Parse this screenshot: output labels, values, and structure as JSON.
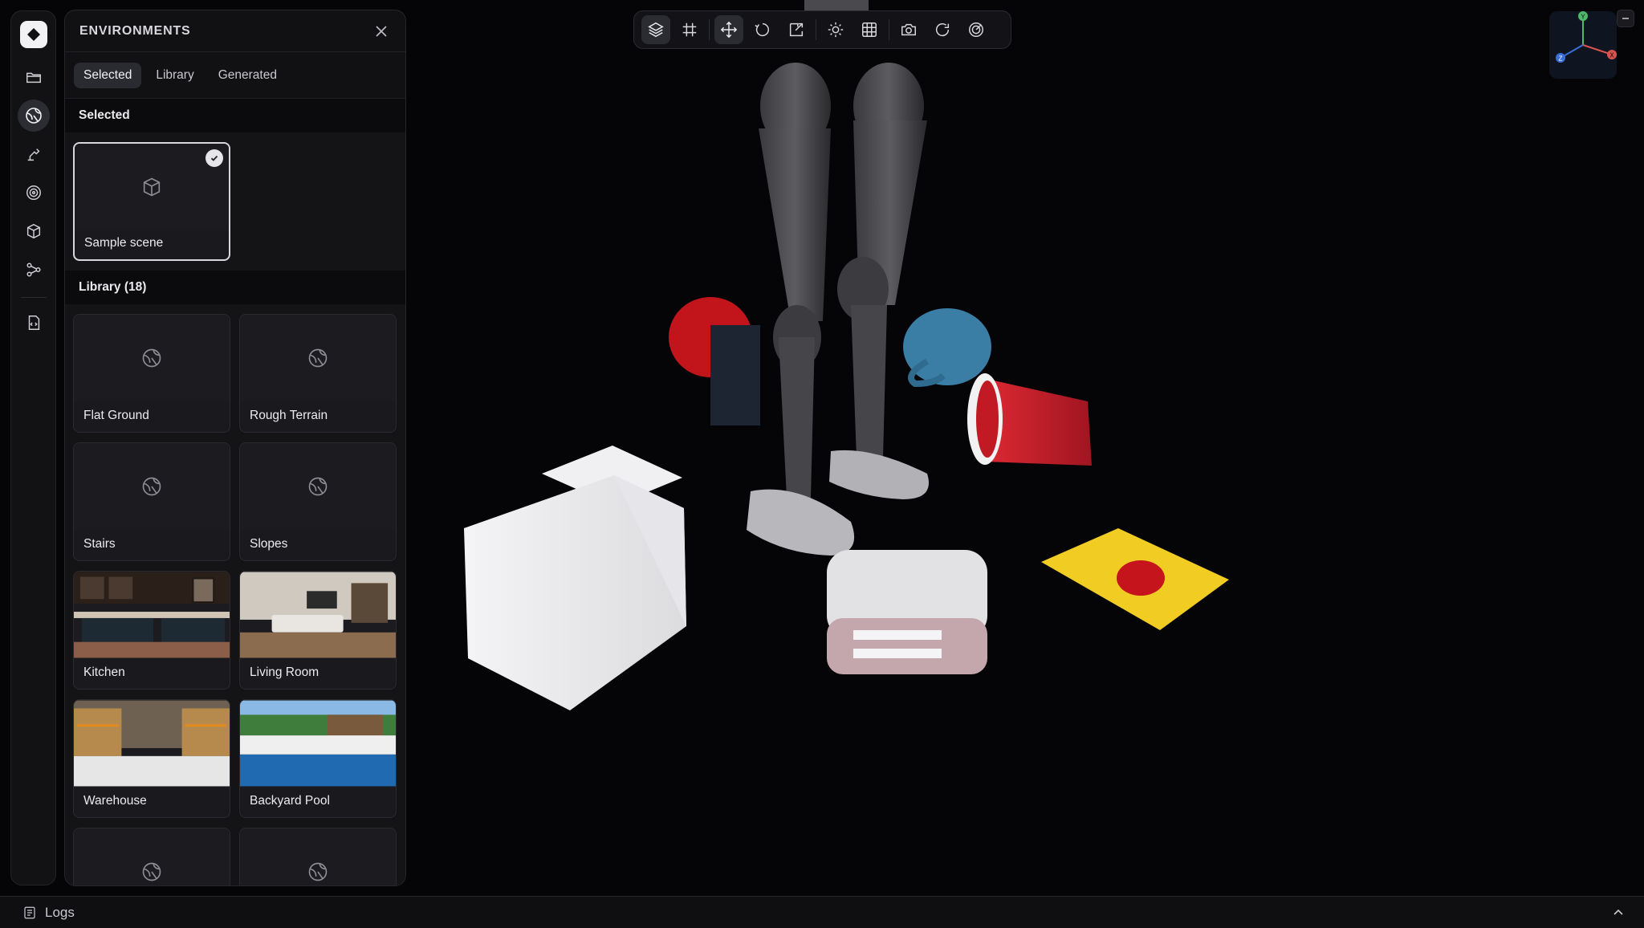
{
  "panel": {
    "title": "ENVIRONMENTS",
    "tabs": [
      {
        "label": "Selected"
      },
      {
        "label": "Library"
      },
      {
        "label": "Generated"
      }
    ],
    "selected_section": "Selected",
    "selected_item": "Sample scene",
    "library_section": "Library (18)",
    "library_items": [
      {
        "label": "Flat Ground"
      },
      {
        "label": "Rough Terrain"
      },
      {
        "label": "Stairs"
      },
      {
        "label": "Slopes"
      },
      {
        "label": "Kitchen"
      },
      {
        "label": "Living Room"
      },
      {
        "label": "Warehouse"
      },
      {
        "label": "Backyard Pool"
      }
    ]
  },
  "gizmo": {
    "y": "Y",
    "x": "X",
    "z": "Z"
  },
  "logs": {
    "label": "Logs"
  },
  "colors": {
    "accent": "#f2f2f4",
    "panel_bg": "#111114",
    "viewport_bg": "#050507"
  }
}
